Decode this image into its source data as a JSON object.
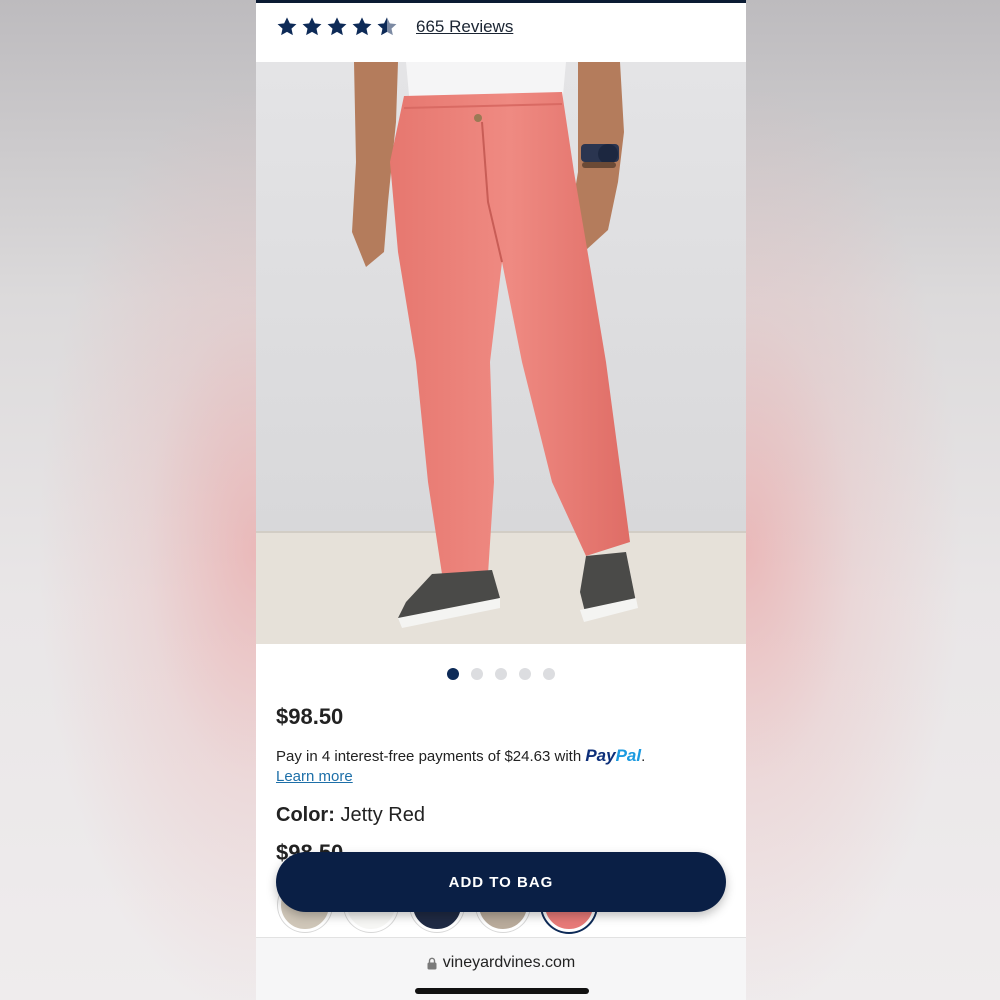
{
  "product": {
    "rating": 4.5,
    "rating_max": 5,
    "reviews_label": "665 Reviews",
    "price": "$98.50",
    "gallery": {
      "image_count": 5,
      "active_index": 0
    },
    "paypal": {
      "text": "Pay in 4 interest-free payments of $24.63 with",
      "logo_part1": "Pay",
      "logo_part2": "Pal",
      "period": ".",
      "learn_more": "Learn more"
    },
    "color_label": "Color:",
    "color_value": "Jetty Red",
    "price_repeat": "$98.50",
    "swatches": [
      {
        "color": "#cfc6b8",
        "selected": false
      },
      {
        "color": "#f6f6f4",
        "selected": false
      },
      {
        "color": "#1f2a44",
        "selected": false
      },
      {
        "color": "#b9ab9b",
        "selected": false
      },
      {
        "color": "#e77a78",
        "selected": true
      }
    ]
  },
  "cta": {
    "label": "ADD TO BAG"
  },
  "browser": {
    "url": "vineyardvines.com"
  },
  "colors": {
    "navy": "#0a1f45",
    "accent_link": "#1d6fa8",
    "star": "#0d2a57"
  }
}
